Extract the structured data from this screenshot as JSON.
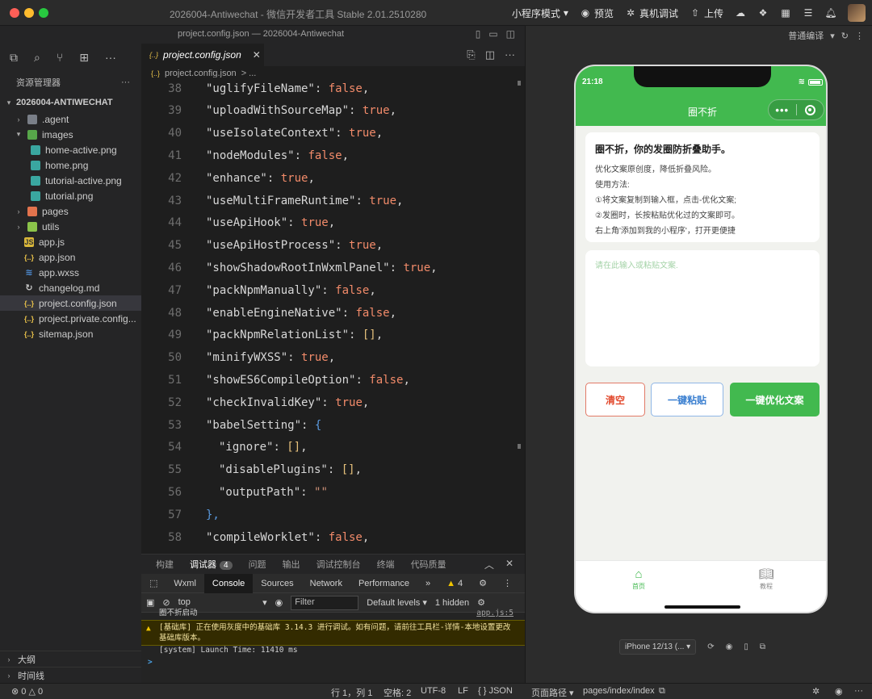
{
  "window": {
    "title": "2026004-Antiwechat - 微信开发者工具 Stable 2.01.2510280",
    "subtitle": "project.config.json — 2026004-Antiwechat"
  },
  "toolbar": {
    "mode": "小程序模式",
    "preview": "预览",
    "real_debug": "真机调试",
    "upload": "上传",
    "compile": "普通编译"
  },
  "explorer": {
    "header": "资源管理器",
    "root": "2026004-ANTIWECHAT",
    "items": [
      {
        "label": ".agent",
        "type": "folder"
      },
      {
        "label": "images",
        "type": "folder-open"
      },
      {
        "label": "home-active.png",
        "type": "image"
      },
      {
        "label": "home.png",
        "type": "image"
      },
      {
        "label": "tutorial-active.png",
        "type": "image"
      },
      {
        "label": "tutorial.png",
        "type": "image"
      },
      {
        "label": "pages",
        "type": "folder"
      },
      {
        "label": "utils",
        "type": "folder"
      },
      {
        "label": "app.js",
        "type": "js"
      },
      {
        "label": "app.json",
        "type": "json"
      },
      {
        "label": "app.wxss",
        "type": "wxss"
      },
      {
        "label": "changelog.md",
        "type": "md"
      },
      {
        "label": "project.config.json",
        "type": "json"
      },
      {
        "label": "project.private.config...",
        "type": "json"
      },
      {
        "label": "sitemap.json",
        "type": "json"
      }
    ],
    "outline": "大纲",
    "timeline": "时间线"
  },
  "editor": {
    "tab_label": "project.config.json",
    "breadcrumb": "project.config.json",
    "breadcrumb_more": "> ...",
    "lines": [
      {
        "n": "38",
        "indent": 1,
        "key": "\"uglifyFileName\"",
        "val": "false",
        "t": "bool"
      },
      {
        "n": "39",
        "indent": 1,
        "key": "\"uploadWithSourceMap\"",
        "val": "true",
        "t": "bool"
      },
      {
        "n": "40",
        "indent": 1,
        "key": "\"useIsolateContext\"",
        "val": "true",
        "t": "bool"
      },
      {
        "n": "41",
        "indent": 1,
        "key": "\"nodeModules\"",
        "val": "false",
        "t": "bool"
      },
      {
        "n": "42",
        "indent": 1,
        "key": "\"enhance\"",
        "val": "true",
        "t": "bool"
      },
      {
        "n": "43",
        "indent": 1,
        "key": "\"useMultiFrameRuntime\"",
        "val": "true",
        "t": "bool"
      },
      {
        "n": "44",
        "indent": 1,
        "key": "\"useApiHook\"",
        "val": "true",
        "t": "bool"
      },
      {
        "n": "45",
        "indent": 1,
        "key": "\"useApiHostProcess\"",
        "val": "true",
        "t": "bool"
      },
      {
        "n": "46",
        "indent": 1,
        "key": "\"showShadowRootInWxmlPanel\"",
        "val": "true",
        "t": "bool"
      },
      {
        "n": "47",
        "indent": 1,
        "key": "\"packNpmManually\"",
        "val": "false",
        "t": "bool"
      },
      {
        "n": "48",
        "indent": 1,
        "key": "\"enableEngineNative\"",
        "val": "false",
        "t": "bool"
      },
      {
        "n": "49",
        "indent": 1,
        "key": "\"packNpmRelationList\"",
        "val": "[]",
        "t": "arr"
      },
      {
        "n": "50",
        "indent": 1,
        "key": "\"minifyWXSS\"",
        "val": "true",
        "t": "bool"
      },
      {
        "n": "51",
        "indent": 1,
        "key": "\"showES6CompileOption\"",
        "val": "false",
        "t": "bool"
      },
      {
        "n": "52",
        "indent": 1,
        "key": "\"checkInvalidKey\"",
        "val": "true",
        "t": "bool"
      },
      {
        "n": "53",
        "indent": 1,
        "key": "\"babelSetting\"",
        "val": "{",
        "t": "brace"
      },
      {
        "n": "54",
        "indent": 2,
        "key": "\"ignore\"",
        "val": "[]",
        "t": "arr"
      },
      {
        "n": "55",
        "indent": 2,
        "key": "\"disablePlugins\"",
        "val": "[]",
        "t": "arr"
      },
      {
        "n": "56",
        "indent": 2,
        "key": "\"outputPath\"",
        "val": "\"\"",
        "t": "str"
      },
      {
        "n": "57",
        "indent": 1,
        "key": "",
        "val": "},",
        "t": "close"
      },
      {
        "n": "58",
        "indent": 1,
        "key": "\"compileWorklet\"",
        "val": "false",
        "t": "bool"
      }
    ]
  },
  "debug": {
    "tabs": [
      "构建",
      "调试器",
      "问题",
      "输出",
      "调试控制台",
      "终端",
      "代码质量"
    ],
    "active_tab": "调试器",
    "debugger_badge": "4",
    "devtools_tabs": [
      "Wxml",
      "Console",
      "Sources",
      "Network",
      "Performance"
    ],
    "active_devtab": "Console",
    "more": "»",
    "warn_count": "4",
    "context": "top",
    "filter_placeholder": "Filter",
    "levels": "Default levels",
    "hidden": "1 hidden",
    "console_lines": [
      {
        "text": "圈不折启动",
        "link": "app.js:5",
        "kind": "log"
      },
      {
        "text": "[基础库] 正在使用灰度中的基础库 3.14.3 进行调试。如有问题，请前往工具栏-详情-本地设置更改基础库版本。",
        "link": "",
        "kind": "warn"
      },
      {
        "text": "[system] Launch Time: 11410 ms",
        "link": "",
        "kind": "log"
      }
    ],
    "prompt": ">"
  },
  "status": {
    "errors": "⊗ 0 △ 0",
    "cursor": "行 1，列 1",
    "spaces": "空格: 2",
    "encoding": "UTF-8",
    "eol": "LF",
    "lang": "{ } JSON",
    "page_path_label": "页面路径",
    "page_path": "pages/index/index"
  },
  "phone": {
    "time": "21:18",
    "nav_title": "圈不折",
    "card_title": "圈不折，你的发圈防折叠助手。",
    "card_lines": [
      "优化文案原创度，降低折叠风险。",
      "使用方法:",
      "①将文案复制到输入框，点击-优化文案;",
      "②发圈时，长按粘贴优化过的文案即可。",
      "右上角'添加到我的小程序'，打开更便捷"
    ],
    "input_placeholder": "请在此输入或粘贴文案.",
    "btn_clear": "清空",
    "btn_paste": "一键粘贴",
    "btn_optimize": "一键优化文案",
    "tab_home": "首页",
    "tab_tutorial": "教程",
    "colors": {
      "brand": "#42b94f",
      "danger": "#e24a2e",
      "info": "#3a7fd0"
    }
  },
  "sim": {
    "device": "iPhone 12/13 (..."
  }
}
